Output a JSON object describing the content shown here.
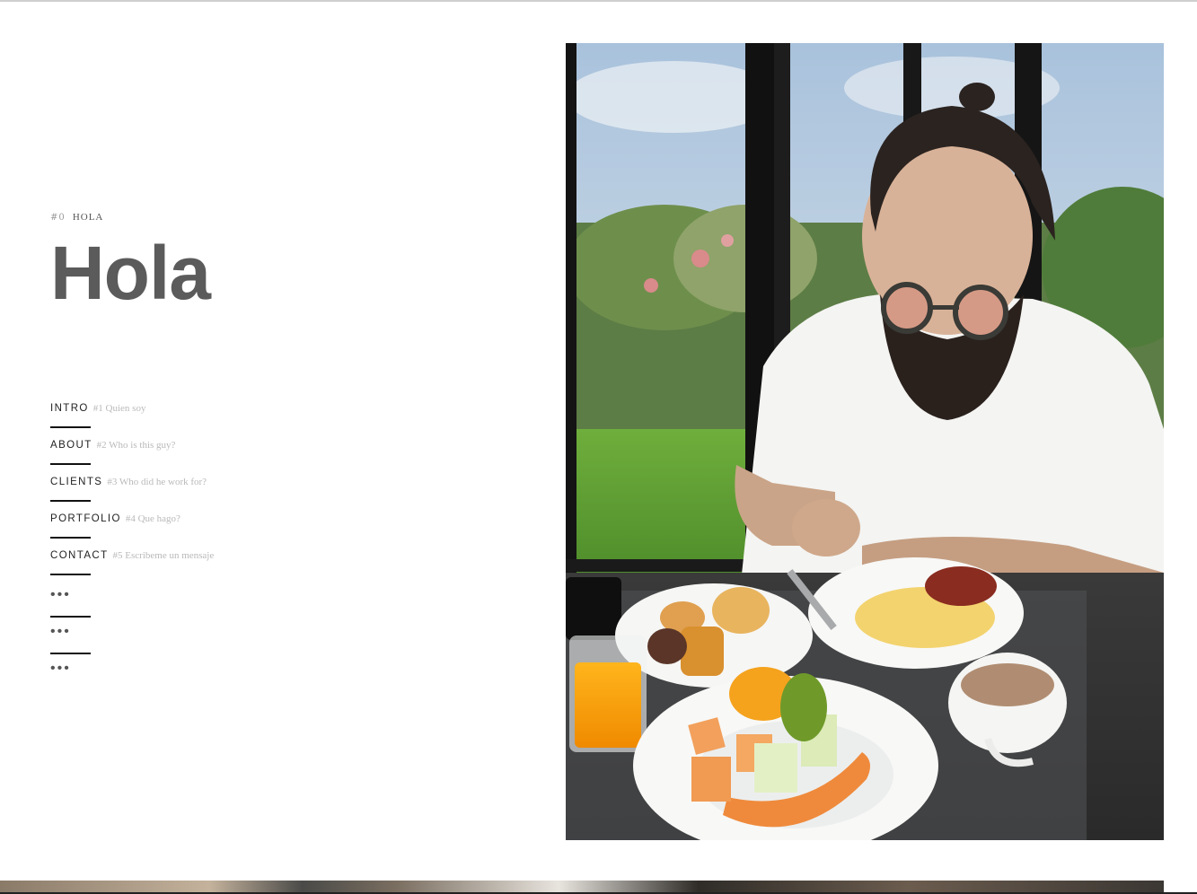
{
  "section_tag": {
    "number": "#0",
    "label": "HOLA"
  },
  "title": "Hola",
  "nav": [
    {
      "label": "INTRO",
      "sub": "#1 Quien soy"
    },
    {
      "label": "ABOUT",
      "sub": "#2 Who is this guy?"
    },
    {
      "label": "CLIENTS",
      "sub": "#3 Who did he work for?"
    },
    {
      "label": "PORTFOLIO",
      "sub": "#4 Que hago?"
    },
    {
      "label": "CONTACT",
      "sub": "#5 Escribeme un mensaje"
    },
    {
      "label": "•••",
      "sub": ""
    },
    {
      "label": "•••",
      "sub": ""
    },
    {
      "label": "•••",
      "sub": ""
    }
  ],
  "colors": {
    "title": "#5b5b5b",
    "nav_text": "#222222",
    "nav_sub": "#b9b9b9",
    "underline": "#111111"
  }
}
